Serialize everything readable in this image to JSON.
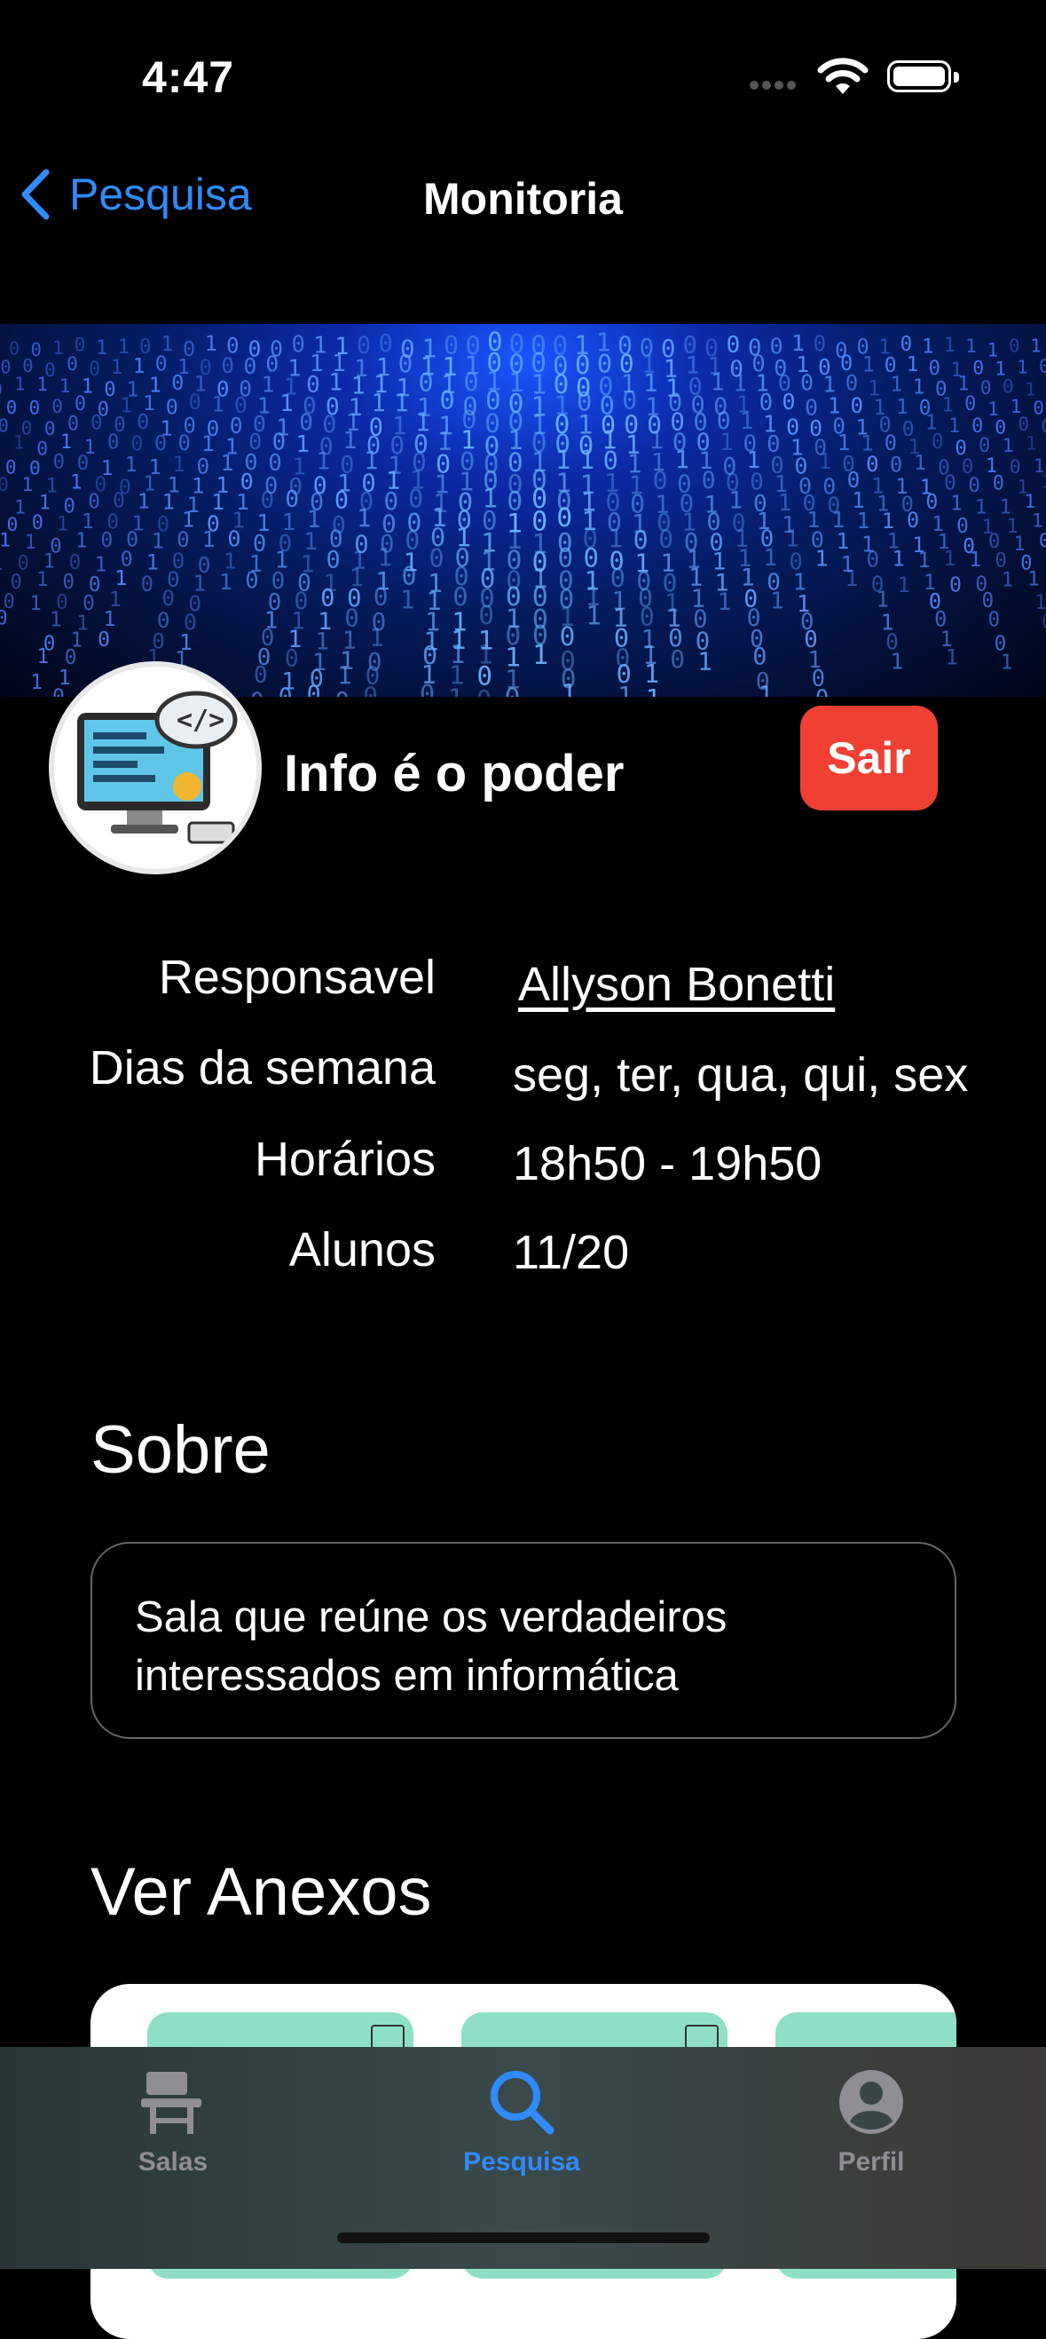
{
  "status_bar": {
    "time": "4:47"
  },
  "nav": {
    "back_label": "Pesquisa",
    "title": "Monitoria"
  },
  "room": {
    "name": "Info é o poder",
    "leave_label": "Sair"
  },
  "info": {
    "responsible_label": "Responsavel",
    "responsible_value": "Allyson Bonetti",
    "days_label": "Dias da semana",
    "days_value": "seg, ter, qua, qui, sex",
    "hours_label": "Horários",
    "hours_value": "18h50 - 19h50",
    "students_label": "Alunos",
    "students_value": "11/20"
  },
  "about": {
    "title": "Sobre",
    "line1": "Sala que reúne os verdadeiros",
    "line2": "interessados em informática"
  },
  "attachments": {
    "title": "Ver Anexos"
  },
  "tabs": [
    {
      "label": "Salas",
      "icon": "school-desk-icon"
    },
    {
      "label": "Pesquisa",
      "icon": "search-icon"
    },
    {
      "label": "Perfil",
      "icon": "person-circle-icon"
    }
  ],
  "colors": {
    "accent": "#2f8bff",
    "danger": "#f04034",
    "background": "#000000"
  }
}
